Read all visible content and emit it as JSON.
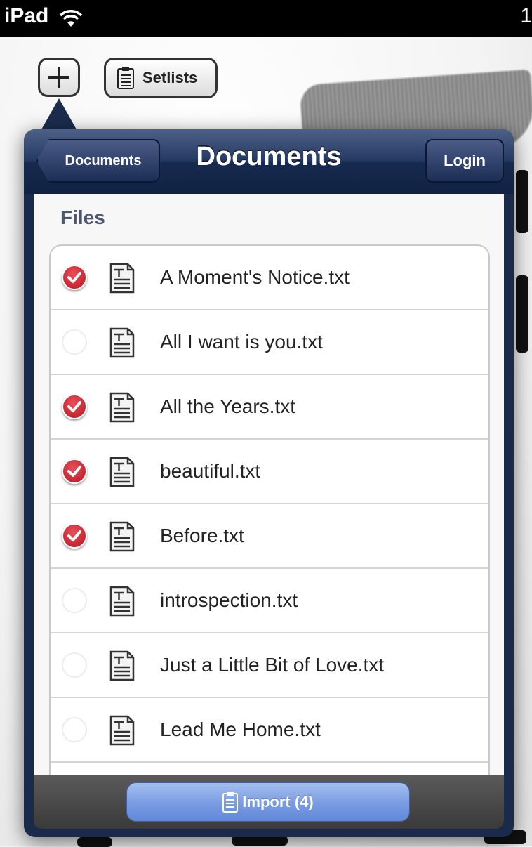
{
  "status_bar": {
    "device_label": "iPad",
    "clipped_text": "1"
  },
  "toolbar": {
    "setlists_label": "Setlists"
  },
  "popover": {
    "title": "Documents",
    "back_label": "Documents",
    "login_label": "Login",
    "section_header": "Files",
    "files": [
      {
        "name": "A Moment's Notice.txt",
        "checked": true
      },
      {
        "name": "All I want is you.txt",
        "checked": false
      },
      {
        "name": "All the Years.txt",
        "checked": true
      },
      {
        "name": "beautiful.txt",
        "checked": true
      },
      {
        "name": "Before.txt",
        "checked": true
      },
      {
        "name": "introspection.txt",
        "checked": false
      },
      {
        "name": "Just a Little Bit of Love.txt",
        "checked": false
      },
      {
        "name": "Lead Me Home.txt",
        "checked": false
      },
      {
        "name": "",
        "checked": false
      }
    ],
    "import_label": "Import (4)"
  },
  "colors": {
    "nav_bar": "#1b2c4d",
    "checkmark": "#c8202c",
    "import_button": "#7c9ee3"
  }
}
